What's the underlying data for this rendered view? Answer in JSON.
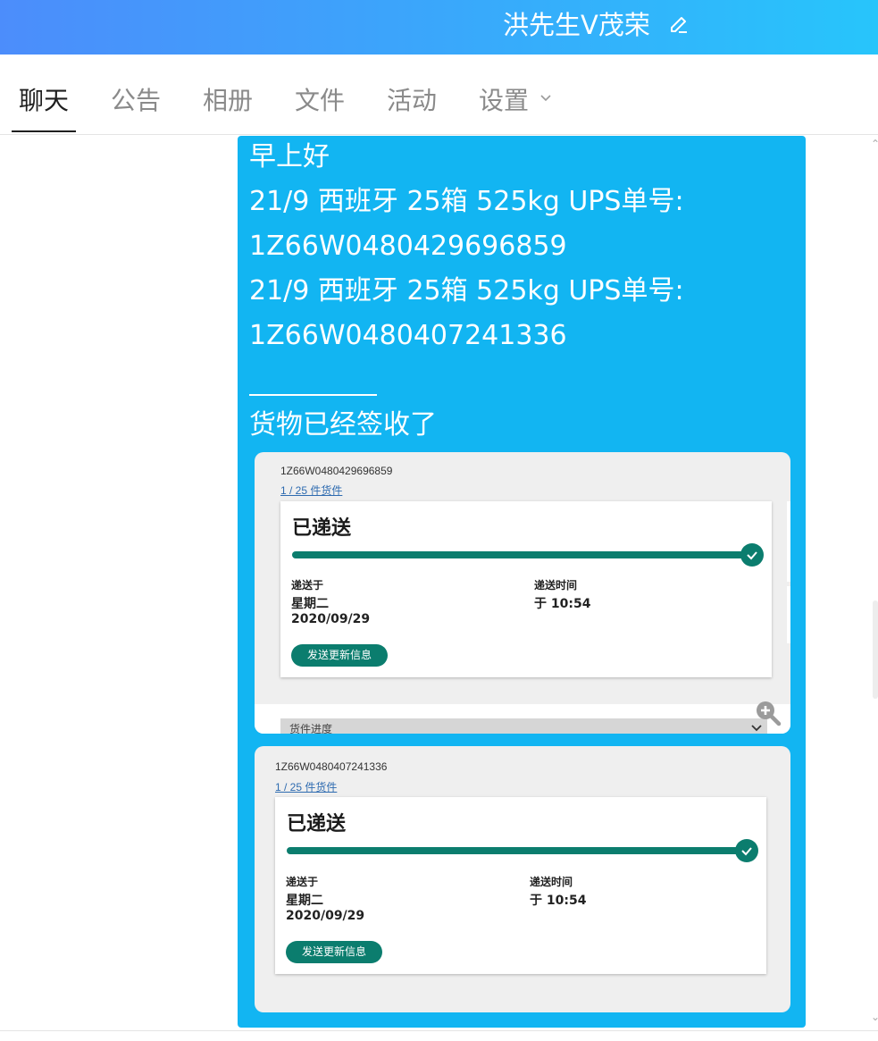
{
  "header": {
    "title": "洪先生V茂荣",
    "edit_icon": "edit-icon"
  },
  "tabs": [
    {
      "label": "聊天",
      "active": true
    },
    {
      "label": "公告"
    },
    {
      "label": "相册"
    },
    {
      "label": "文件"
    },
    {
      "label": "活动"
    },
    {
      "label": "设置",
      "has_dropdown": true
    }
  ],
  "message": {
    "lines": [
      "早上好",
      "21/9 西班牙 25箱  525kg UPS单号:",
      "1Z66W0480429696859",
      "21/9 西班牙 25箱  525kg UPS单号:",
      "1Z66W0480407241336",
      "货物已经签收了"
    ],
    "bubble_color": "#12b5f2"
  },
  "cards": [
    {
      "tracking_id": "1Z66W0480429696859",
      "pieces_link": "1 / 25 件货件",
      "status": "已递送",
      "delivered_on_label": "递送于",
      "delivered_day": "星期二",
      "delivered_date": "2020/09/29",
      "delivery_time_label": "递送时间",
      "delivery_time": "于 10:54",
      "update_button": "发送更新信息",
      "collapsed_row": "货件进度"
    },
    {
      "tracking_id": "1Z66W0480407241336",
      "pieces_link": "1 / 25 件货件",
      "status": "已递送",
      "delivered_on_label": "递送于",
      "delivered_day": "星期二",
      "delivered_date": "2020/09/29",
      "delivery_time_label": "递送时间",
      "delivery_time": "于 10:54",
      "update_button": "发送更新信息"
    }
  ],
  "colors": {
    "accent": "#0b7d6e",
    "header_start": "#4c8dfb",
    "header_end": "#27c5fb"
  }
}
